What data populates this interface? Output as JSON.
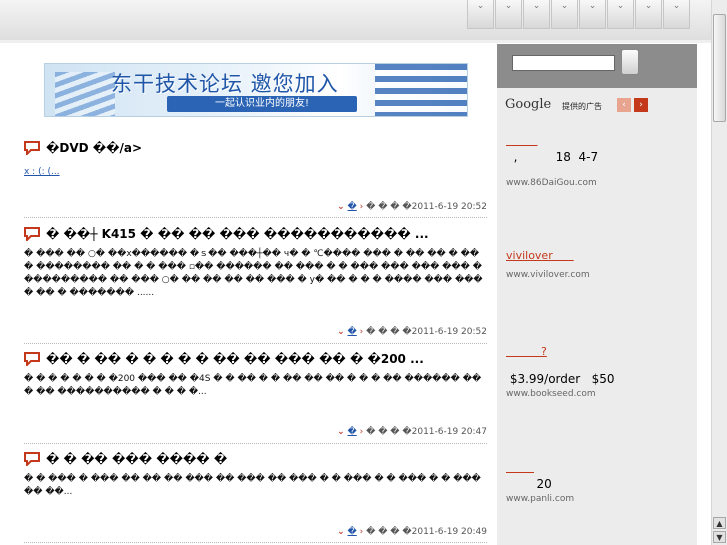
{
  "nav": {
    "tabs": [
      "⌄",
      "⌄",
      "⌄",
      "⌄",
      "⌄",
      "⌄",
      "⌄",
      "⌄"
    ]
  },
  "banner": {
    "title": "东干技术论坛 邀您加入",
    "subtitle": "一起认识业内的朋友!"
  },
  "posts": [
    {
      "title": "�DVD  ��/a>",
      "link": "x : (: (...",
      "meta": {
        "author": "�",
        "text": "� � � �2011-6-19 20:52"
      }
    },
    {
      "title": "� ��┼ K415 � �� �� ��� ����������� ...",
      "body": "� ��� �� ○�   ��x������ �ｓ�� ���┼�� ч� � ℃���� ��� � �� �� � �� � �������� �� � � ��� ▫�� ������ �� ��� � � ��� ��� ��� ��� � ��������� �� ��� ○� �� �� �� �� ��� � у� �� � � � ���� ��� ��� � �� � ������� ......",
      "meta": {
        "author": "�",
        "text": "� � � �2011-6-19 20:52"
      }
    },
    {
      "title": "��  �   ��  � � � � �  �� �� ��� �� � �200 ...",
      "body": "� � � � � � � �200  ���  �� �4S � �  �� � � �� �� �� � � � �� ������ ���  �� ���������� � � �   �...",
      "meta": {
        "author": "�",
        "text": "� � � �2011-6-19 20:47"
      }
    },
    {
      "title": "�  � �� ��� ���� �",
      "body": "� � ��� � ��� �� �� �� ��� �� ��� �� ��� � � ��� � � ��� � � ��� �� ��...",
      "meta": {
        "author": "�",
        "text": "� � � �2011-6-19 20:49"
      }
    }
  ],
  "sidebar": {
    "search": {
      "placeholder": ""
    },
    "ads_header": {
      "logo": "Google",
      "label": "提供的广告",
      "prev": "‹",
      "next": "›"
    },
    "ads": [
      {
        "title": "         ",
        "text": "  ,          18  4-7",
        "url": "www.86DaiGou.com"
      },
      {
        "title": "vivilover      ",
        "text": "",
        "url": "www.vivilover.com"
      },
      {
        "title": "          ?",
        "text": " $3.99/order   $50",
        "url": "www.bookseed.com"
      },
      {
        "title": "        ",
        "text": "        20",
        "url": "www.panli.com"
      }
    ]
  },
  "colors": {
    "accent": "#c4391c",
    "link": "#2255aa",
    "sidebar_bg": "#ececec",
    "search_bg": "#8c8c8c"
  }
}
